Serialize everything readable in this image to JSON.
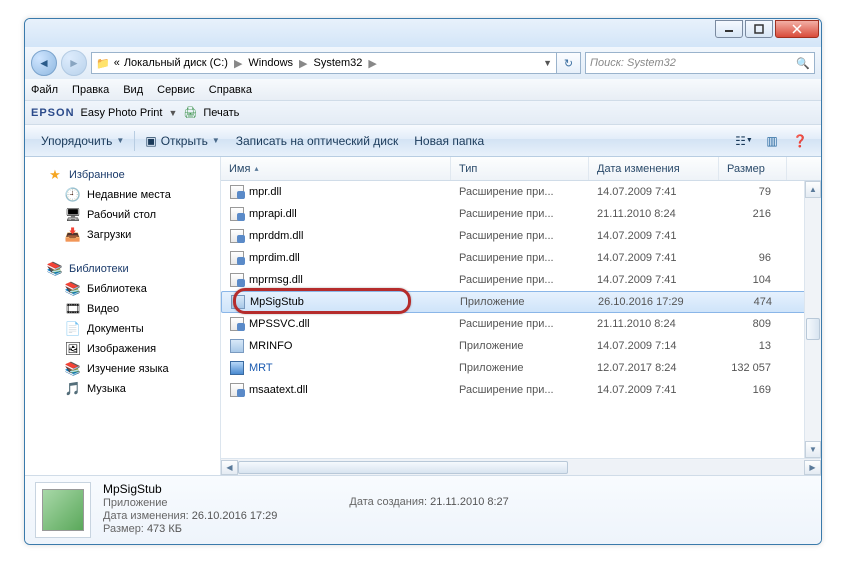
{
  "breadcrumb": {
    "prefix": "«",
    "parts": [
      "Локальный диск (C:)",
      "Windows",
      "System32"
    ]
  },
  "search": {
    "placeholder": "Поиск: System32"
  },
  "menu": {
    "file": "Файл",
    "edit": "Правка",
    "view": "Вид",
    "service": "Сервис",
    "help": "Справка"
  },
  "epson": {
    "brand": "EPSON",
    "app": "Easy Photo Print",
    "print": "Печать"
  },
  "toolbar": {
    "organize": "Упорядочить",
    "open": "Открыть",
    "burn": "Записать на оптический диск",
    "newfolder": "Новая папка"
  },
  "sidebar": {
    "fav": "Избранное",
    "fav_items": [
      "Недавние места",
      "Рабочий стол",
      "Загрузки"
    ],
    "lib": "Библиотеки",
    "lib_items": [
      "Библиотека",
      "Видео",
      "Документы",
      "Изображения",
      "Изучение языка",
      "Музыка"
    ]
  },
  "columns": {
    "name": "Имя",
    "type": "Тип",
    "date": "Дата изменения",
    "size": "Размер"
  },
  "files": [
    {
      "name": "mpr.dll",
      "type": "Расширение при...",
      "date": "14.07.2009 7:41",
      "size": "79",
      "icon": "dll",
      "sel": false
    },
    {
      "name": "mprapi.dll",
      "type": "Расширение при...",
      "date": "21.11.2010 8:24",
      "size": "216",
      "icon": "dll",
      "sel": false
    },
    {
      "name": "mprddm.dll",
      "type": "Расширение при...",
      "date": "14.07.2009 7:41",
      "size": "",
      "icon": "dll",
      "sel": false
    },
    {
      "name": "mprdim.dll",
      "type": "Расширение при...",
      "date": "14.07.2009 7:41",
      "size": "96",
      "icon": "dll",
      "sel": false
    },
    {
      "name": "mprmsg.dll",
      "type": "Расширение при...",
      "date": "14.07.2009 7:41",
      "size": "104",
      "icon": "dll",
      "sel": false
    },
    {
      "name": "MpSigStub",
      "type": "Приложение",
      "date": "26.10.2016 17:29",
      "size": "474",
      "icon": "exe",
      "sel": true
    },
    {
      "name": "MPSSVC.dll",
      "type": "Расширение при...",
      "date": "21.11.2010 8:24",
      "size": "809",
      "icon": "dll",
      "sel": false
    },
    {
      "name": "MRINFO",
      "type": "Приложение",
      "date": "14.07.2009 7:14",
      "size": "13",
      "icon": "exe",
      "sel": false
    },
    {
      "name": "MRT",
      "type": "Приложение",
      "date": "12.07.2017 8:24",
      "size": "132 057",
      "icon": "mrt",
      "sel": false
    },
    {
      "name": "msaatext.dll",
      "type": "Расширение при...",
      "date": "14.07.2009 7:41",
      "size": "169",
      "icon": "dll",
      "sel": false
    }
  ],
  "details": {
    "name": "MpSigStub",
    "type": "Приложение",
    "mod_label": "Дата изменения:",
    "mod": "26.10.2016 17:29",
    "size_label": "Размер:",
    "size": "473 КБ",
    "created_label": "Дата создания:",
    "created": "21.11.2010 8:27"
  }
}
